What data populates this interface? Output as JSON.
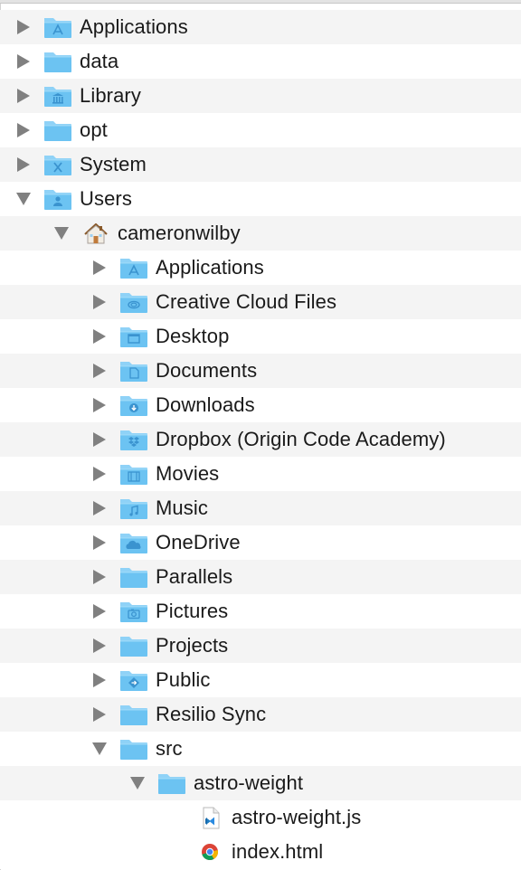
{
  "tree": [
    {
      "label": "Applications",
      "depth": 0,
      "state": "collapsed",
      "icon": "folder-applications-icon",
      "bg": "even"
    },
    {
      "label": "data",
      "depth": 0,
      "state": "collapsed",
      "icon": "folder-icon",
      "bg": "odd"
    },
    {
      "label": "Library",
      "depth": 0,
      "state": "collapsed",
      "icon": "folder-library-icon",
      "bg": "even"
    },
    {
      "label": "opt",
      "depth": 0,
      "state": "collapsed",
      "icon": "folder-icon",
      "bg": "odd"
    },
    {
      "label": "System",
      "depth": 0,
      "state": "collapsed",
      "icon": "folder-system-icon",
      "bg": "even"
    },
    {
      "label": "Users",
      "depth": 0,
      "state": "expanded",
      "icon": "folder-users-icon",
      "bg": "odd"
    },
    {
      "label": "cameronwilby",
      "depth": 1,
      "state": "expanded",
      "icon": "home-icon",
      "bg": "even"
    },
    {
      "label": "Applications",
      "depth": 2,
      "state": "collapsed",
      "icon": "folder-applications-icon",
      "bg": "odd"
    },
    {
      "label": "Creative Cloud Files",
      "depth": 2,
      "state": "collapsed",
      "icon": "folder-creative-cloud-icon",
      "bg": "even"
    },
    {
      "label": "Desktop",
      "depth": 2,
      "state": "collapsed",
      "icon": "folder-desktop-icon",
      "bg": "odd"
    },
    {
      "label": "Documents",
      "depth": 2,
      "state": "collapsed",
      "icon": "folder-documents-icon",
      "bg": "even"
    },
    {
      "label": "Downloads",
      "depth": 2,
      "state": "collapsed",
      "icon": "folder-downloads-icon",
      "bg": "odd"
    },
    {
      "label": "Dropbox (Origin Code Academy)",
      "depth": 2,
      "state": "collapsed",
      "icon": "folder-dropbox-icon",
      "bg": "even"
    },
    {
      "label": "Movies",
      "depth": 2,
      "state": "collapsed",
      "icon": "folder-movies-icon",
      "bg": "odd"
    },
    {
      "label": "Music",
      "depth": 2,
      "state": "collapsed",
      "icon": "folder-music-icon",
      "bg": "even"
    },
    {
      "label": "OneDrive",
      "depth": 2,
      "state": "collapsed",
      "icon": "folder-onedrive-icon",
      "bg": "odd"
    },
    {
      "label": "Parallels",
      "depth": 2,
      "state": "collapsed",
      "icon": "folder-icon",
      "bg": "even"
    },
    {
      "label": "Pictures",
      "depth": 2,
      "state": "collapsed",
      "icon": "folder-pictures-icon",
      "bg": "odd"
    },
    {
      "label": "Projects",
      "depth": 2,
      "state": "collapsed",
      "icon": "folder-icon",
      "bg": "even"
    },
    {
      "label": "Public",
      "depth": 2,
      "state": "collapsed",
      "icon": "folder-public-icon",
      "bg": "odd"
    },
    {
      "label": "Resilio Sync",
      "depth": 2,
      "state": "collapsed",
      "icon": "folder-icon",
      "bg": "even"
    },
    {
      "label": "src",
      "depth": 2,
      "state": "expanded",
      "icon": "folder-icon",
      "bg": "odd"
    },
    {
      "label": "astro-weight",
      "depth": 3,
      "state": "expanded",
      "icon": "folder-icon",
      "bg": "even"
    },
    {
      "label": "astro-weight.js",
      "depth": 4,
      "state": "leaf",
      "icon": "vscode-file-icon",
      "bg": "odd"
    },
    {
      "label": "index.html",
      "depth": 4,
      "state": "leaf",
      "icon": "chrome-file-icon",
      "bg": "odd"
    }
  ],
  "colors": {
    "folder_body": "#6cc3f2",
    "folder_tab": "#8fd2f7",
    "folder_glyph": "#3a93cf",
    "disclosure": "#808080",
    "stripe": "#f4f4f4"
  }
}
